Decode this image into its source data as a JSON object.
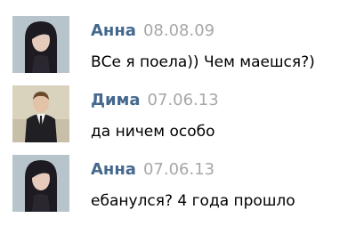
{
  "messages": [
    {
      "author": "Анна",
      "time": "08.08.09",
      "text": "ВСе я поела)) Чем маешся?)",
      "avatar": "avatar-anna"
    },
    {
      "author": "Дима",
      "time": "07.06.13",
      "text": "да ничем особо",
      "avatar": "avatar-dima"
    },
    {
      "author": "Анна",
      "time": "07.06.13",
      "text": "ебанулся? 4 года прошло",
      "avatar": "avatar-anna"
    }
  ],
  "colors": {
    "author": "#45688e",
    "time": "#a7a7a7",
    "text": "#000000"
  }
}
